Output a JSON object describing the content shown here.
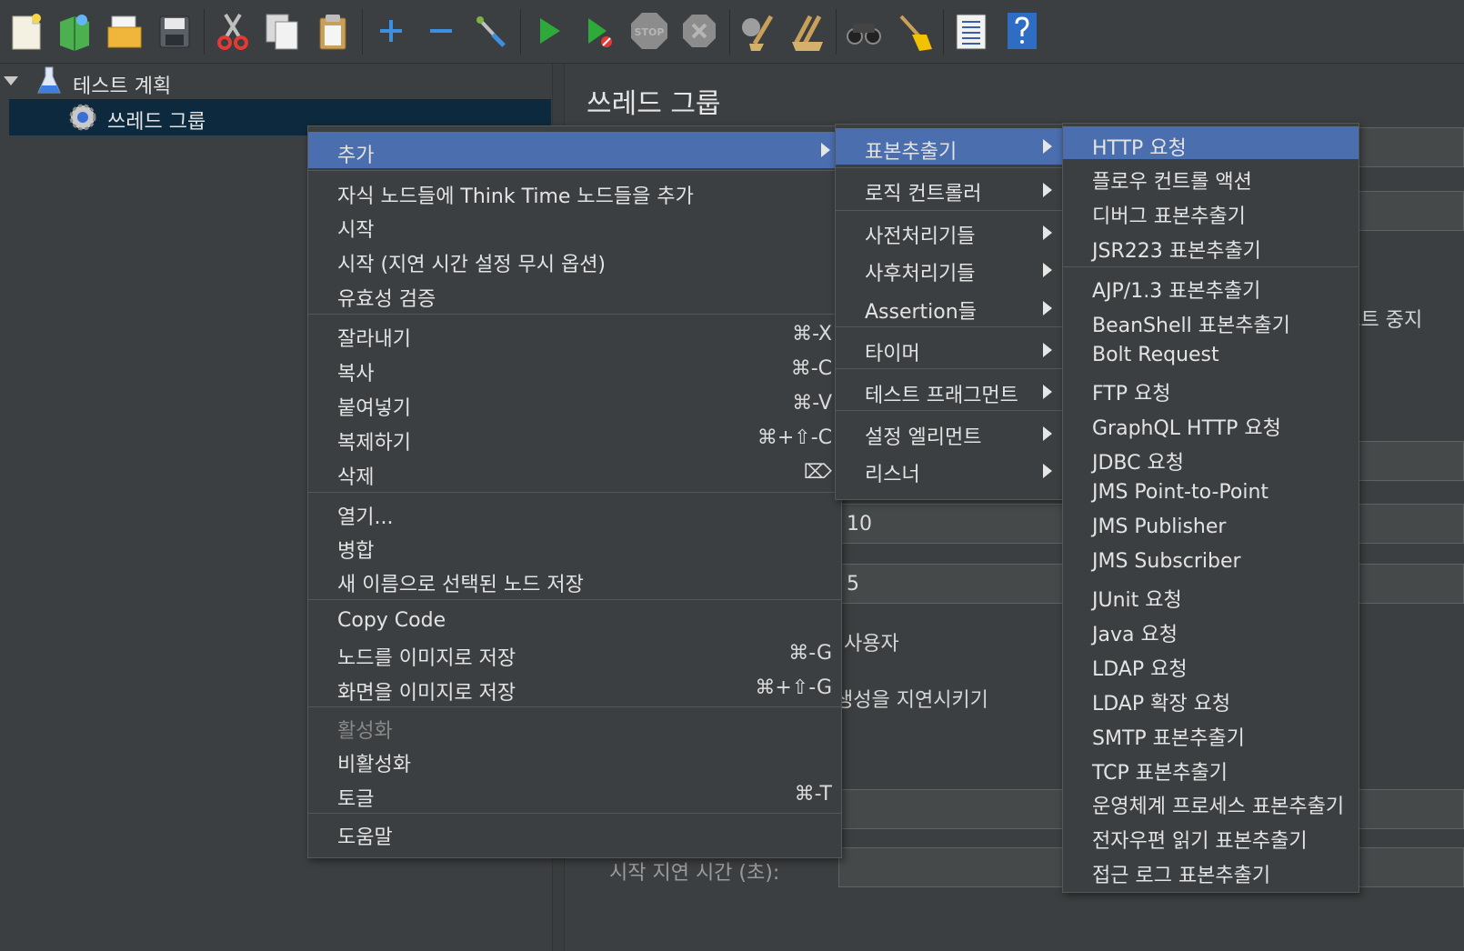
{
  "toolbar": {
    "buttons": [
      "new-icon",
      "templates-icon",
      "open-icon",
      "save-icon",
      "cut-icon",
      "copy-icon",
      "paste-icon",
      "expand-icon",
      "collapse-icon",
      "toggle-icon",
      "start-icon",
      "start-no-pause-icon",
      "stop-icon",
      "shutdown-icon",
      "clear-icon",
      "clear-all-icon",
      "search-icon",
      "reset-search-icon",
      "function-helper-icon",
      "help-icon"
    ],
    "stop_label": "STOP"
  },
  "tree": {
    "root_label": "테스트 계획",
    "child_label": "쓰레드 그룹"
  },
  "content": {
    "title": "쓰레드 그룹",
    "partial_stop_text": "테스트 중지",
    "value_threads": "10",
    "value_rampup": "5",
    "partial_user_text": "사용자",
    "partial_delay_text": "생성을 지연시키기",
    "start_delay_label": "시작 지연 시간 (초):"
  },
  "menu": {
    "items": [
      {
        "label": "추가",
        "submenu": true,
        "selected": true
      },
      {
        "label": "자식 노드들에 Think Time 노드들을 추가"
      },
      {
        "label": "시작"
      },
      {
        "label": "시작 (지연 시간 설정 무시 옵션)"
      },
      {
        "label": "유효성 검증"
      },
      {
        "label": "잘라내기",
        "shortcut": "⌘-X"
      },
      {
        "label": "복사",
        "shortcut": "⌘-C"
      },
      {
        "label": "붙여넣기",
        "shortcut": "⌘-V"
      },
      {
        "label": "복제하기",
        "shortcut": "⌘+⇧-C"
      },
      {
        "label": "삭제",
        "shortcut": "⌦"
      },
      {
        "label": "열기..."
      },
      {
        "label": "병합"
      },
      {
        "label": "새 이름으로 선택된 노드 저장"
      },
      {
        "label": "Copy Code"
      },
      {
        "label": "노드를 이미지로 저장",
        "shortcut": "⌘-G"
      },
      {
        "label": "화면을 이미지로 저장",
        "shortcut": "⌘+⇧-G"
      },
      {
        "label": "활성화",
        "disabled": true
      },
      {
        "label": "비활성화"
      },
      {
        "label": "토글",
        "shortcut": "⌘-T"
      },
      {
        "label": "도움말"
      }
    ]
  },
  "submenu_add": {
    "items": [
      {
        "label": "표본추출기",
        "selected": true
      },
      {
        "label": "로직 컨트롤러"
      },
      {
        "label": "사전처리기들"
      },
      {
        "label": "사후처리기들"
      },
      {
        "label": "Assertion들"
      },
      {
        "label": "타이머"
      },
      {
        "label": "테스트 프래그먼트"
      },
      {
        "label": "설정 엘리먼트"
      },
      {
        "label": "리스너"
      }
    ]
  },
  "submenu_samplers": {
    "items": [
      {
        "label": "HTTP 요청",
        "selected": true
      },
      {
        "label": "플로우 컨트롤 액션"
      },
      {
        "label": "디버그 표본추출기"
      },
      {
        "label": "JSR223 표본추출기"
      },
      {
        "label": "AJP/1.3 표본추출기"
      },
      {
        "label": "BeanShell 표본추출기"
      },
      {
        "label": "Bolt Request"
      },
      {
        "label": "FTP 요청"
      },
      {
        "label": "GraphQL HTTP 요청"
      },
      {
        "label": "JDBC 요청"
      },
      {
        "label": "JMS Point-to-Point"
      },
      {
        "label": "JMS Publisher"
      },
      {
        "label": "JMS Subscriber"
      },
      {
        "label": "JUnit 요청"
      },
      {
        "label": "Java 요청"
      },
      {
        "label": "LDAP 요청"
      },
      {
        "label": "LDAP 확장 요청"
      },
      {
        "label": "SMTP 표본추출기"
      },
      {
        "label": "TCP 표본추출기"
      },
      {
        "label": "운영체계 프로세스 표본추출기"
      },
      {
        "label": "전자우편 읽기 표본추출기"
      },
      {
        "label": "접근 로그 표본추출기"
      }
    ]
  }
}
